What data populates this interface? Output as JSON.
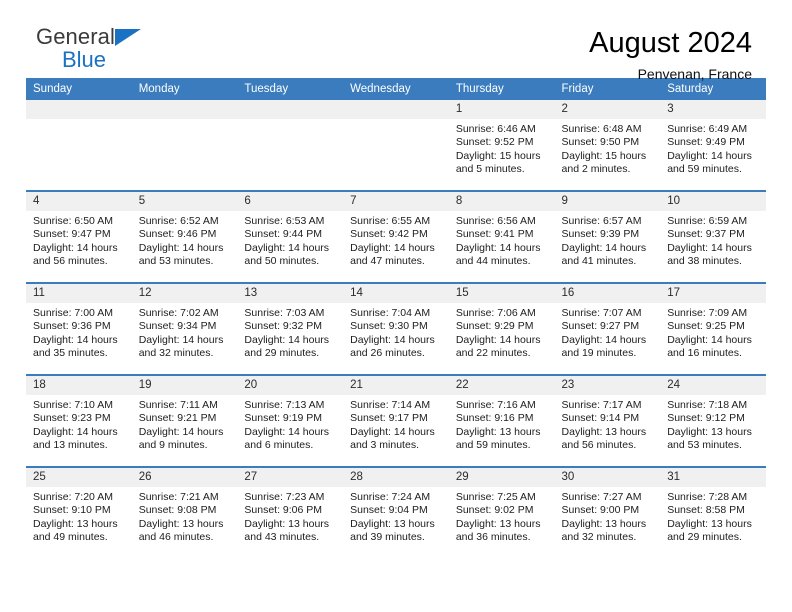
{
  "brand": {
    "name_top": "General",
    "name_bottom": "Blue",
    "accent_color": "#1a72c4"
  },
  "header": {
    "title": "August 2024",
    "subtitle": "Penvenan, France"
  },
  "calendar": {
    "header_color": "#3a7cbe",
    "daynum_band_color": "#f0f0f0",
    "weekday_headers": [
      "Sunday",
      "Monday",
      "Tuesday",
      "Wednesday",
      "Thursday",
      "Friday",
      "Saturday"
    ],
    "labels": {
      "sunrise": "Sunrise:",
      "sunset": "Sunset:",
      "daylight": "Daylight:"
    },
    "weeks": [
      [
        {
          "empty": true
        },
        {
          "empty": true
        },
        {
          "empty": true
        },
        {
          "empty": true
        },
        {
          "day": "1",
          "sunrise": "Sunrise: 6:46 AM",
          "sunset": "Sunset: 9:52 PM",
          "daylight_1": "Daylight: 15 hours",
          "daylight_2": "and 5 minutes."
        },
        {
          "day": "2",
          "sunrise": "Sunrise: 6:48 AM",
          "sunset": "Sunset: 9:50 PM",
          "daylight_1": "Daylight: 15 hours",
          "daylight_2": "and 2 minutes."
        },
        {
          "day": "3",
          "sunrise": "Sunrise: 6:49 AM",
          "sunset": "Sunset: 9:49 PM",
          "daylight_1": "Daylight: 14 hours",
          "daylight_2": "and 59 minutes."
        }
      ],
      [
        {
          "day": "4",
          "sunrise": "Sunrise: 6:50 AM",
          "sunset": "Sunset: 9:47 PM",
          "daylight_1": "Daylight: 14 hours",
          "daylight_2": "and 56 minutes."
        },
        {
          "day": "5",
          "sunrise": "Sunrise: 6:52 AM",
          "sunset": "Sunset: 9:46 PM",
          "daylight_1": "Daylight: 14 hours",
          "daylight_2": "and 53 minutes."
        },
        {
          "day": "6",
          "sunrise": "Sunrise: 6:53 AM",
          "sunset": "Sunset: 9:44 PM",
          "daylight_1": "Daylight: 14 hours",
          "daylight_2": "and 50 minutes."
        },
        {
          "day": "7",
          "sunrise": "Sunrise: 6:55 AM",
          "sunset": "Sunset: 9:42 PM",
          "daylight_1": "Daylight: 14 hours",
          "daylight_2": "and 47 minutes."
        },
        {
          "day": "8",
          "sunrise": "Sunrise: 6:56 AM",
          "sunset": "Sunset: 9:41 PM",
          "daylight_1": "Daylight: 14 hours",
          "daylight_2": "and 44 minutes."
        },
        {
          "day": "9",
          "sunrise": "Sunrise: 6:57 AM",
          "sunset": "Sunset: 9:39 PM",
          "daylight_1": "Daylight: 14 hours",
          "daylight_2": "and 41 minutes."
        },
        {
          "day": "10",
          "sunrise": "Sunrise: 6:59 AM",
          "sunset": "Sunset: 9:37 PM",
          "daylight_1": "Daylight: 14 hours",
          "daylight_2": "and 38 minutes."
        }
      ],
      [
        {
          "day": "11",
          "sunrise": "Sunrise: 7:00 AM",
          "sunset": "Sunset: 9:36 PM",
          "daylight_1": "Daylight: 14 hours",
          "daylight_2": "and 35 minutes."
        },
        {
          "day": "12",
          "sunrise": "Sunrise: 7:02 AM",
          "sunset": "Sunset: 9:34 PM",
          "daylight_1": "Daylight: 14 hours",
          "daylight_2": "and 32 minutes."
        },
        {
          "day": "13",
          "sunrise": "Sunrise: 7:03 AM",
          "sunset": "Sunset: 9:32 PM",
          "daylight_1": "Daylight: 14 hours",
          "daylight_2": "and 29 minutes."
        },
        {
          "day": "14",
          "sunrise": "Sunrise: 7:04 AM",
          "sunset": "Sunset: 9:30 PM",
          "daylight_1": "Daylight: 14 hours",
          "daylight_2": "and 26 minutes."
        },
        {
          "day": "15",
          "sunrise": "Sunrise: 7:06 AM",
          "sunset": "Sunset: 9:29 PM",
          "daylight_1": "Daylight: 14 hours",
          "daylight_2": "and 22 minutes."
        },
        {
          "day": "16",
          "sunrise": "Sunrise: 7:07 AM",
          "sunset": "Sunset: 9:27 PM",
          "daylight_1": "Daylight: 14 hours",
          "daylight_2": "and 19 minutes."
        },
        {
          "day": "17",
          "sunrise": "Sunrise: 7:09 AM",
          "sunset": "Sunset: 9:25 PM",
          "daylight_1": "Daylight: 14 hours",
          "daylight_2": "and 16 minutes."
        }
      ],
      [
        {
          "day": "18",
          "sunrise": "Sunrise: 7:10 AM",
          "sunset": "Sunset: 9:23 PM",
          "daylight_1": "Daylight: 14 hours",
          "daylight_2": "and 13 minutes."
        },
        {
          "day": "19",
          "sunrise": "Sunrise: 7:11 AM",
          "sunset": "Sunset: 9:21 PM",
          "daylight_1": "Daylight: 14 hours",
          "daylight_2": "and 9 minutes."
        },
        {
          "day": "20",
          "sunrise": "Sunrise: 7:13 AM",
          "sunset": "Sunset: 9:19 PM",
          "daylight_1": "Daylight: 14 hours",
          "daylight_2": "and 6 minutes."
        },
        {
          "day": "21",
          "sunrise": "Sunrise: 7:14 AM",
          "sunset": "Sunset: 9:17 PM",
          "daylight_1": "Daylight: 14 hours",
          "daylight_2": "and 3 minutes."
        },
        {
          "day": "22",
          "sunrise": "Sunrise: 7:16 AM",
          "sunset": "Sunset: 9:16 PM",
          "daylight_1": "Daylight: 13 hours",
          "daylight_2": "and 59 minutes."
        },
        {
          "day": "23",
          "sunrise": "Sunrise: 7:17 AM",
          "sunset": "Sunset: 9:14 PM",
          "daylight_1": "Daylight: 13 hours",
          "daylight_2": "and 56 minutes."
        },
        {
          "day": "24",
          "sunrise": "Sunrise: 7:18 AM",
          "sunset": "Sunset: 9:12 PM",
          "daylight_1": "Daylight: 13 hours",
          "daylight_2": "and 53 minutes."
        }
      ],
      [
        {
          "day": "25",
          "sunrise": "Sunrise: 7:20 AM",
          "sunset": "Sunset: 9:10 PM",
          "daylight_1": "Daylight: 13 hours",
          "daylight_2": "and 49 minutes."
        },
        {
          "day": "26",
          "sunrise": "Sunrise: 7:21 AM",
          "sunset": "Sunset: 9:08 PM",
          "daylight_1": "Daylight: 13 hours",
          "daylight_2": "and 46 minutes."
        },
        {
          "day": "27",
          "sunrise": "Sunrise: 7:23 AM",
          "sunset": "Sunset: 9:06 PM",
          "daylight_1": "Daylight: 13 hours",
          "daylight_2": "and 43 minutes."
        },
        {
          "day": "28",
          "sunrise": "Sunrise: 7:24 AM",
          "sunset": "Sunset: 9:04 PM",
          "daylight_1": "Daylight: 13 hours",
          "daylight_2": "and 39 minutes."
        },
        {
          "day": "29",
          "sunrise": "Sunrise: 7:25 AM",
          "sunset": "Sunset: 9:02 PM",
          "daylight_1": "Daylight: 13 hours",
          "daylight_2": "and 36 minutes."
        },
        {
          "day": "30",
          "sunrise": "Sunrise: 7:27 AM",
          "sunset": "Sunset: 9:00 PM",
          "daylight_1": "Daylight: 13 hours",
          "daylight_2": "and 32 minutes."
        },
        {
          "day": "31",
          "sunrise": "Sunrise: 7:28 AM",
          "sunset": "Sunset: 8:58 PM",
          "daylight_1": "Daylight: 13 hours",
          "daylight_2": "and 29 minutes."
        }
      ]
    ]
  }
}
